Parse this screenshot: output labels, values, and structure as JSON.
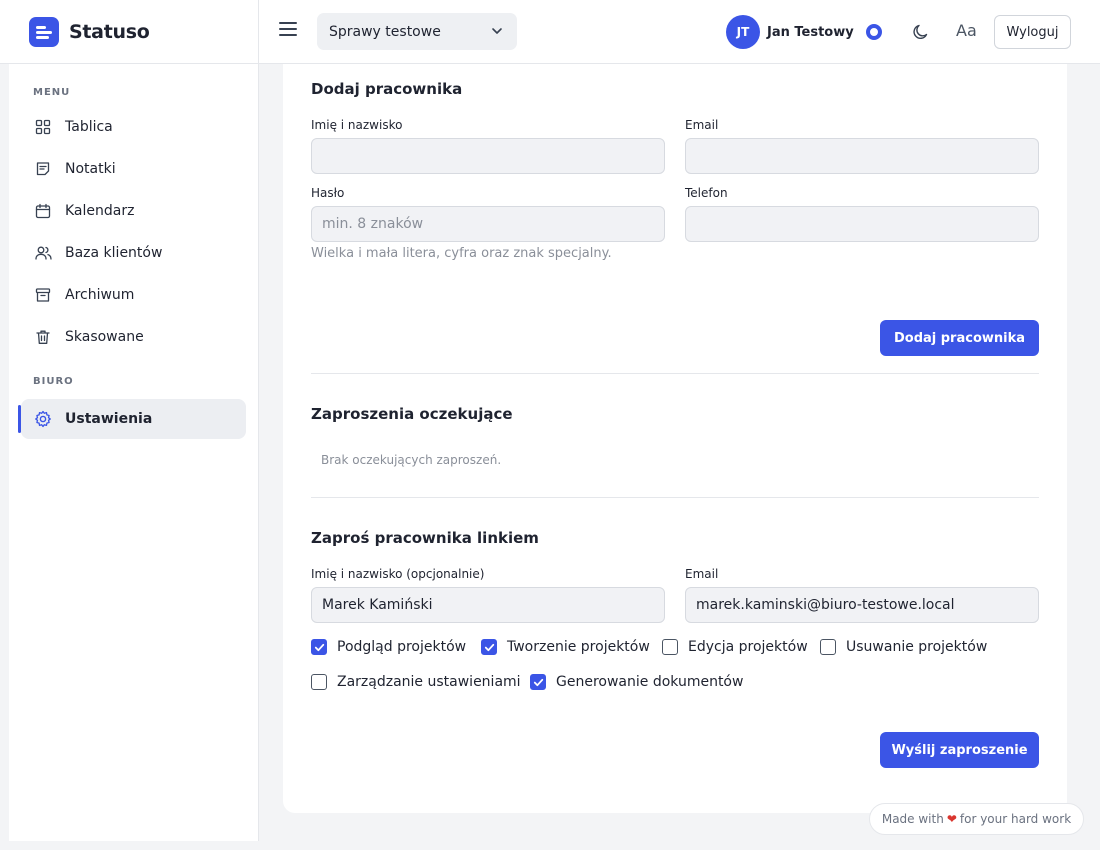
{
  "brand": {
    "name": "Statuso",
    "accent": "#3b55e6"
  },
  "header": {
    "case_select": "Sprawy testowe",
    "user_initials": "JT",
    "user_name": "Jan Testowy",
    "font_toggle": "Aa",
    "logout": "Wyloguj"
  },
  "sidebar": {
    "menu_label": "MENU",
    "office_label": "BIURO",
    "items": [
      {
        "label": "Tablica",
        "icon": "grid-icon"
      },
      {
        "label": "Notatki",
        "icon": "note-icon"
      },
      {
        "label": "Kalendarz",
        "icon": "calendar-icon"
      },
      {
        "label": "Baza klientów",
        "icon": "users-icon"
      },
      {
        "label": "Archiwum",
        "icon": "archive-icon"
      },
      {
        "label": "Skasowane",
        "icon": "trash-icon"
      }
    ],
    "active": {
      "label": "Ustawienia",
      "icon": "gear-icon"
    }
  },
  "add_employee": {
    "title": "Dodaj pracownika",
    "name_label": "Imię i nazwisko",
    "name_value": "",
    "email_label": "Email",
    "email_value": "",
    "password_label": "Hasło",
    "password_placeholder": "min. 8 znaków",
    "password_hint": "Wielka i mała litera, cyfra oraz znak specjalny.",
    "phone_label": "Telefon",
    "phone_value": "",
    "submit": "Dodaj pracownika"
  },
  "pending": {
    "title": "Zaproszenia oczekujące",
    "empty": "Brak oczekujących zaproszeń."
  },
  "invite": {
    "title": "Zaproś pracownika linkiem",
    "name_label": "Imię i nazwisko (opcjonalnie)",
    "name_value": "Marek Kamiński",
    "email_label": "Email",
    "email_value": "marek.kaminski@biuro-testowe.local",
    "permissions": [
      {
        "label": "Podgląd projektów",
        "checked": true
      },
      {
        "label": "Tworzenie projektów",
        "checked": true
      },
      {
        "label": "Edycja projektów",
        "checked": false
      },
      {
        "label": "Usuwanie projektów",
        "checked": false
      },
      {
        "label": "Zarządzanie ustawieniami",
        "checked": false
      },
      {
        "label": "Generowanie dokumentów",
        "checked": true
      }
    ],
    "submit": "Wyślij zaproszenie"
  },
  "footer": {
    "made_with": "Made with",
    "for_text": "for your hard work"
  }
}
